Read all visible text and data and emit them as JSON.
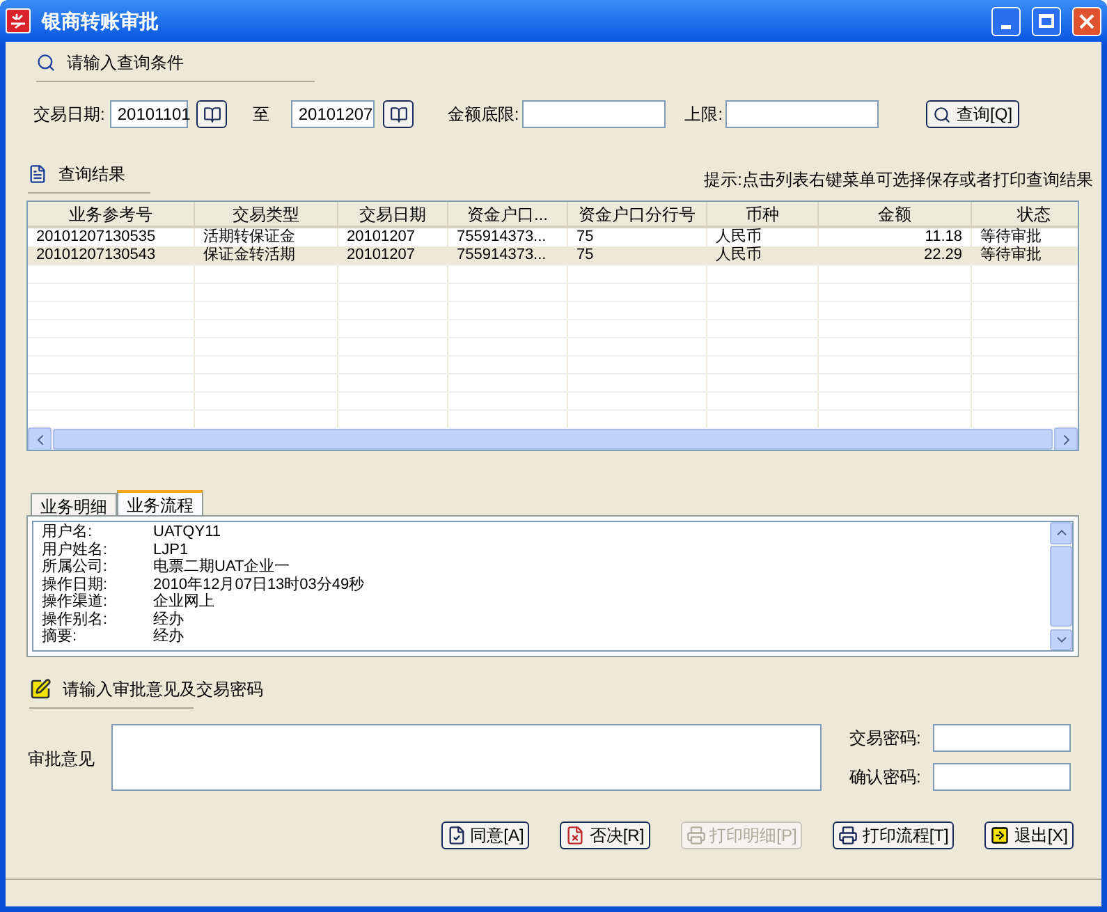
{
  "window": {
    "title": "银商转账审批"
  },
  "query": {
    "heading": "请输入查询条件",
    "date_label": "交易日期:",
    "date_from": "20101101",
    "to_label": "至",
    "date_to": "20101207",
    "min_label": "金额底限:",
    "max_label": "上限:",
    "button": "查询[Q]"
  },
  "results": {
    "heading": "查询结果",
    "hint": "提示:点击列表右键菜单可选择保存或者打印查询结果",
    "columns": [
      "业务参考号",
      "交易类型",
      "交易日期",
      "资金户口...",
      "资金户口分行号",
      "币种",
      "金额",
      "状态"
    ],
    "rows": [
      {
        "selected": false,
        "cells": [
          "20101207130535",
          "活期转保证金",
          "20101207",
          "755914373...",
          "75",
          "人民币",
          "11.18",
          "等待审批"
        ]
      },
      {
        "selected": true,
        "cells": [
          "20101207130543",
          "保证金转活期",
          "20101207",
          "755914373...",
          "75",
          "人民币",
          "22.29",
          "等待审批"
        ]
      }
    ]
  },
  "tabs": [
    {
      "label": "业务明细",
      "selected": false
    },
    {
      "label": "业务流程",
      "selected": true
    }
  ],
  "details": [
    {
      "label": "用户名:",
      "value": "UATQY11"
    },
    {
      "label": "用户姓名:",
      "value": "LJP1"
    },
    {
      "label": "所属公司:",
      "value": "电票二期UAT企业一"
    },
    {
      "label": "操作日期:",
      "value": "2010年12月07日13时03分49秒"
    },
    {
      "label": "操作渠道:",
      "value": "企业网上"
    },
    {
      "label": "操作别名:",
      "value": "经办"
    },
    {
      "label": "摘要:",
      "value": "经办"
    }
  ],
  "approval": {
    "heading": "请输入审批意见及交易密码",
    "opinion_label": "审批意见",
    "password_label": "交易密码:",
    "confirm_label": "确认密码:"
  },
  "buttons": [
    {
      "label": "同意[A]",
      "kind": "agree",
      "disabled": false
    },
    {
      "label": "否决[R]",
      "kind": "reject",
      "disabled": false
    },
    {
      "label": "打印明细[P]",
      "kind": "print",
      "disabled": true
    },
    {
      "label": "打印流程[T]",
      "kind": "print",
      "disabled": false
    },
    {
      "label": "退出[X]",
      "kind": "exit",
      "disabled": false
    }
  ]
}
